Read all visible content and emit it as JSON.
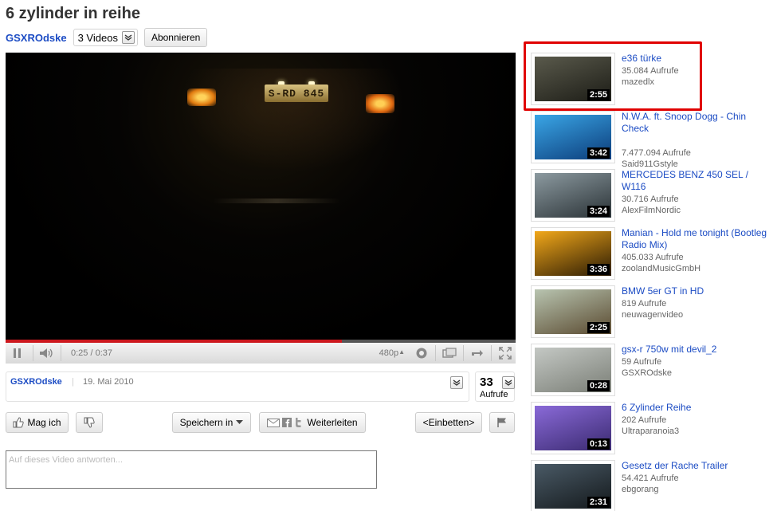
{
  "video": {
    "title": "6 zylinder in reihe",
    "owner": "GSXROdske",
    "videos_label": "3 Videos",
    "subscribe_label": "Abonnieren",
    "plate_text": "S-RD 845",
    "time": "0:25 / 0:37",
    "progress": 0.66,
    "quality": "480p",
    "upload_date": "19. Mai 2010",
    "views": "33",
    "views_label": "Aufrufe"
  },
  "actions": {
    "like_label": "Mag ich",
    "save_label": "Speichern in",
    "share_label": "Weiterleiten",
    "embed_label": "<Einbetten>"
  },
  "reply": {
    "placeholder": "Auf dieses Video antworten..."
  },
  "related": [
    {
      "title": "e36 türke",
      "views": "35.084 Aufrufe",
      "user": "mazedlx",
      "duration": "2:55",
      "colors": [
        "#5a5a4c",
        "#1c1c16"
      ]
    },
    {
      "title": "N.W.A. ft. Snoop Dogg - Chin Check",
      "views": "7.477.094 Aufrufe",
      "user": "Said911Gstyle",
      "duration": "3:42",
      "colors": [
        "#3aa6e6",
        "#0c3c7a"
      ]
    },
    {
      "title": "MERCEDES BENZ 450 SEL / W116",
      "views": "30.716 Aufrufe",
      "user": "AlexFilmNordic",
      "duration": "3:24",
      "colors": [
        "#8c9aa0",
        "#2a3236"
      ]
    },
    {
      "title": "Manian - Hold me tonight (Bootleg Radio Mix)",
      "views": "405.033 Aufrufe",
      "user": "zoolandMusicGmbH",
      "duration": "3:36",
      "colors": [
        "#f2a81a",
        "#2a1a04"
      ]
    },
    {
      "title": "BMW 5er GT in HD",
      "views": "819 Aufrufe",
      "user": "neuwagenvideo",
      "duration": "2:25",
      "colors": [
        "#b8c4b0",
        "#5a4a30"
      ]
    },
    {
      "title": "gsx-r 750w mit devil_2",
      "views": "59 Aufrufe",
      "user": "GSXROdske",
      "duration": "0:28",
      "colors": [
        "#c4c8c4",
        "#7a7e76"
      ]
    },
    {
      "title": "6 Zylinder Reihe",
      "views": "202 Aufrufe",
      "user": "Ultraparanoia3",
      "duration": "0:13",
      "colors": [
        "#8a6ad8",
        "#3a2a70"
      ]
    },
    {
      "title": "Gesetz der Rache Trailer",
      "views": "54.421 Aufrufe",
      "user": "ebgorang",
      "duration": "2:31",
      "colors": [
        "#4a5a66",
        "#14191c"
      ]
    }
  ]
}
